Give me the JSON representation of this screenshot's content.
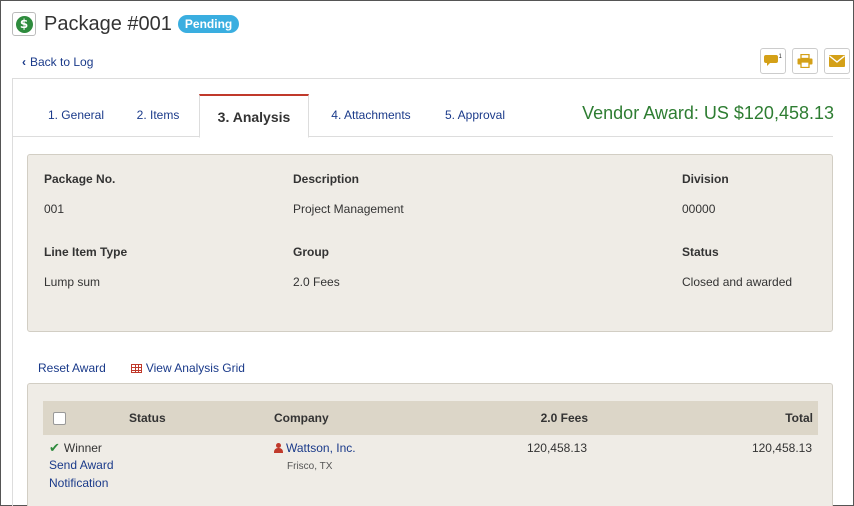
{
  "header": {
    "title": "Package #001",
    "status_badge": "Pending",
    "back_link": "Back to Log",
    "comment_count": "1"
  },
  "tabs": [
    {
      "label": "1. General"
    },
    {
      "label": "2. Items"
    },
    {
      "label": "3. Analysis"
    },
    {
      "label": "4. Attachments"
    },
    {
      "label": "5. Approval"
    }
  ],
  "vendor_award": "Vendor Award: US $120,458.13",
  "info": {
    "package_no_label": "Package No.",
    "package_no_value": "001",
    "description_label": "Description",
    "description_value": "Project Management",
    "division_label": "Division",
    "division_value": "00000",
    "line_item_type_label": "Line Item Type",
    "line_item_type_value": "Lump sum",
    "group_label": "Group",
    "group_value": "2.0 Fees",
    "status_label": "Status",
    "status_value": "Closed and awarded"
  },
  "links": {
    "reset_award": "Reset Award",
    "view_analysis_grid": "View Analysis Grid"
  },
  "table": {
    "columns": [
      "Status",
      "Company",
      "2.0 Fees",
      "Total"
    ],
    "rows": [
      {
        "status": "Winner",
        "send_award": "Send Award",
        "notification": "Notification",
        "company": "Wattson, Inc.",
        "location": "Frisco, TX",
        "fees": "120,458.13",
        "total": "120,458.13"
      }
    ]
  },
  "colors": {
    "accent_green": "#2e7d32",
    "badge_blue": "#3aaee0",
    "link_blue": "#1a3a8a",
    "icon_gold": "#d4a017",
    "active_tab_red": "#c0392b"
  }
}
